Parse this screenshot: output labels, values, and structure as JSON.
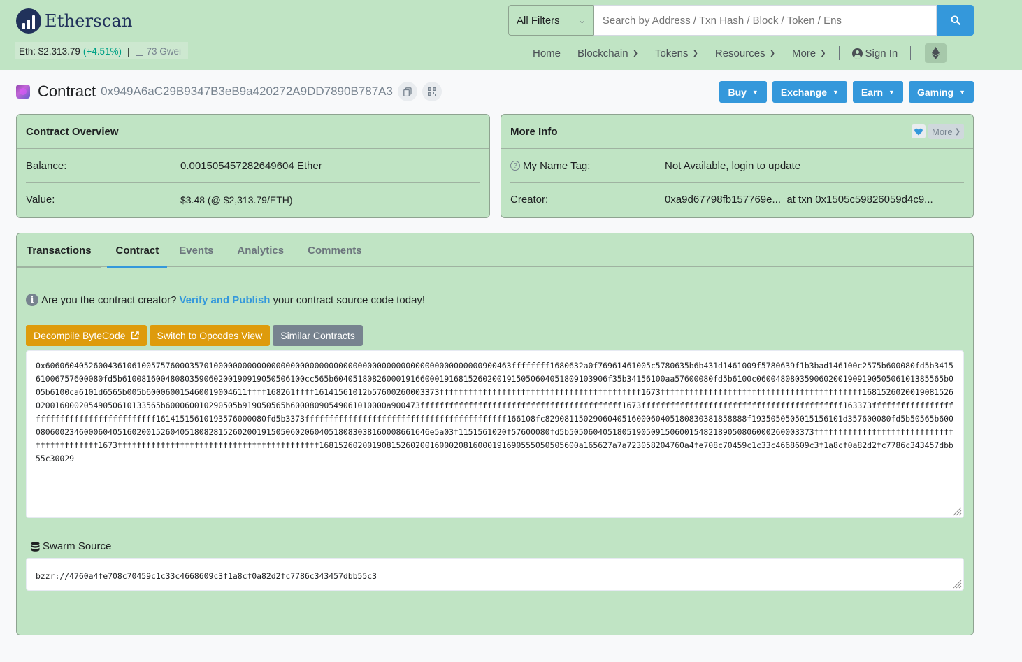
{
  "brand": {
    "name": "Etherscan"
  },
  "price": {
    "label": "Eth:",
    "value": "$2,313.79",
    "change": "(+4.51%)",
    "separator": "|",
    "gas": "73 Gwei"
  },
  "search": {
    "filter": "All Filters",
    "placeholder": "Search by Address / Txn Hash / Block / Token / Ens"
  },
  "nav": {
    "items": [
      "Home",
      "Blockchain",
      "Tokens",
      "Resources",
      "More"
    ],
    "sign_in": "Sign In"
  },
  "page": {
    "title_label": "Contract",
    "address": "0x949A6aC29B9347B3eB9a420272A9DD7890B787A3"
  },
  "actions": [
    "Buy",
    "Exchange",
    "Earn",
    "Gaming"
  ],
  "overview": {
    "title": "Contract Overview",
    "balance_label": "Balance:",
    "balance_value": "0.001505457282649604 Ether",
    "value_label": "Value:",
    "value_value": "$3.48 (@ $2,313.79/ETH)"
  },
  "more_info": {
    "title": "More Info",
    "more_label": "More",
    "name_tag_label": "My Name Tag:",
    "name_tag_value": "Not Available, login to update",
    "creator_label": "Creator:",
    "creator_addr": "0xa9d67798fb157769e...",
    "creator_txn_prefix": "at txn",
    "creator_txn": "0x1505c59826059d4c9..."
  },
  "tabs": [
    "Transactions",
    "Contract",
    "Events",
    "Analytics",
    "Comments"
  ],
  "contract": {
    "notice_prefix": "Are you the contract creator?",
    "notice_link": "Verify and Publish",
    "notice_suffix": "your contract source code today!",
    "btn_decompile": "Decompile ByteCode",
    "btn_opcodes": "Switch to Opcodes View",
    "btn_similar": "Similar Contracts",
    "bytecode": "0x6060604052600436106100575760003570100000000000000000000000000000000000000000000000000000000900463ffffffff1680632a0f76961461005c5780635b6b431d1461009f5780639f1b3bad146100c2575b600080fd5b341561006757600080fd5b61008160048080359060200190919050506100cc565b604051808260001916600019168152602001915050604051809103906f35b34156100aa57600080fd5b6100c060048080359060200190919050506101385565b005b6100ca6101d6565b005b600060015460019004611ffff168261ffff16141561012b57600260003373ffffffffffffffffffffffffffffffffffffffffff1673ffffffffffffffffffffffffffffffffffffffffff168152602001908152602001600020549050610133565b600060010290505b919050565b60008090549061010000a900473ffffffffffffffffffffffffffffffffffffffffff1673ffffffffffffffffffffffffffffffffffffffffff163373ffffffffffffffffffffffffffffffffffffffffff16141515610193576000080fd5b3373ffffffffffffffffffffffffffffffffffffffffff166108fc829081150290604051600060405180830381858888f1935050505015156101d357600080fd5b50565b6000806002346000604051602001526040518082815260200191505060206040518083038160008661646e5a03f1151561020f57600080fd5b505060405180519050915060015482189050806000260003373ffffffffffffffffffffffffffffffffffffffffff1673ffffffffffffffffffffffffffffffffffffffffff168152602001908152602001600020816000191690555050505600a165627a7a723058204760a4fe708c70459c1c33c4668609c3f1a8cf0a82d2fc7786c343457dbb55c30029",
    "swarm_label": "Swarm Source",
    "swarm_value": "bzzr://4760a4fe708c70459c1c33c4668609c3f1a8cf0a82d2fc7786c343457dbb55c3"
  },
  "colors": {
    "accent": "#3498db",
    "warning": "#de9b0c",
    "secondary": "#77838f",
    "panel": "#c0e4c4",
    "positive": "#00a186"
  }
}
